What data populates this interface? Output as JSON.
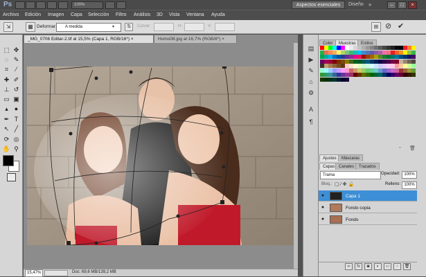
{
  "app": {
    "logo": "Ps",
    "zoom_value": "100%",
    "workspace_button": "Aspectos esenciales",
    "design_button": "Diseño",
    "more_button": "»",
    "window_controls": [
      "–",
      "□",
      "×"
    ]
  },
  "menu": [
    "Archivo",
    "Edición",
    "Imagen",
    "Capa",
    "Selección",
    "Filtro",
    "Análisis",
    "3D",
    "Vista",
    "Ventana",
    "Ayuda"
  ],
  "options": {
    "deform_label": "Deformar:",
    "deform_value": "A medida",
    "curve_label": "Curvar:",
    "h_label": "H:",
    "v_label": "V:",
    "cancel_glyph": "⊘",
    "commit_glyph": "✔"
  },
  "document": {
    "tabs": [
      {
        "label": "_MG_0706 Editar-2.tif al 15,5% (Capa 1, RGB/16*) ×",
        "active": true
      },
      {
        "label": "Humo08.jpg al 16,7% (RGB/8*) ×",
        "active": false
      }
    ],
    "zoom": "15,47%",
    "doc_size": "Doc: 69,6 MB/139,2 MB"
  },
  "swatches_panel": {
    "tabs": [
      "Color",
      "Muestras",
      "Estilos"
    ],
    "active_tab": "Muestras"
  },
  "adjust_panel": {
    "tabs": [
      "Ajustes",
      "Máscaras"
    ]
  },
  "layers_panel": {
    "tabs": [
      "Capas",
      "Canales",
      "Trazados"
    ],
    "blend_mode": "Trama",
    "opacity_label": "Opacidad:",
    "opacity_value": "100%",
    "lock_label": "Bloq.:",
    "fill_label": "Relleno:",
    "fill_value": "100%",
    "layers": [
      {
        "name": "Capa 1",
        "selected": true,
        "visible": true
      },
      {
        "name": "Fondo copia",
        "selected": false,
        "visible": true
      },
      {
        "name": "Fondo",
        "selected": false,
        "visible": true
      }
    ],
    "footer_icons": [
      "link-icon",
      "fx-icon",
      "mask-icon",
      "adjustment-icon",
      "folder-icon",
      "new-layer-icon",
      "trash-icon"
    ]
  },
  "colors": {
    "selection_blue": "#3d8fd6",
    "foreground": "#000000",
    "background": "#ffffff",
    "body_red": "#c01a2a"
  }
}
